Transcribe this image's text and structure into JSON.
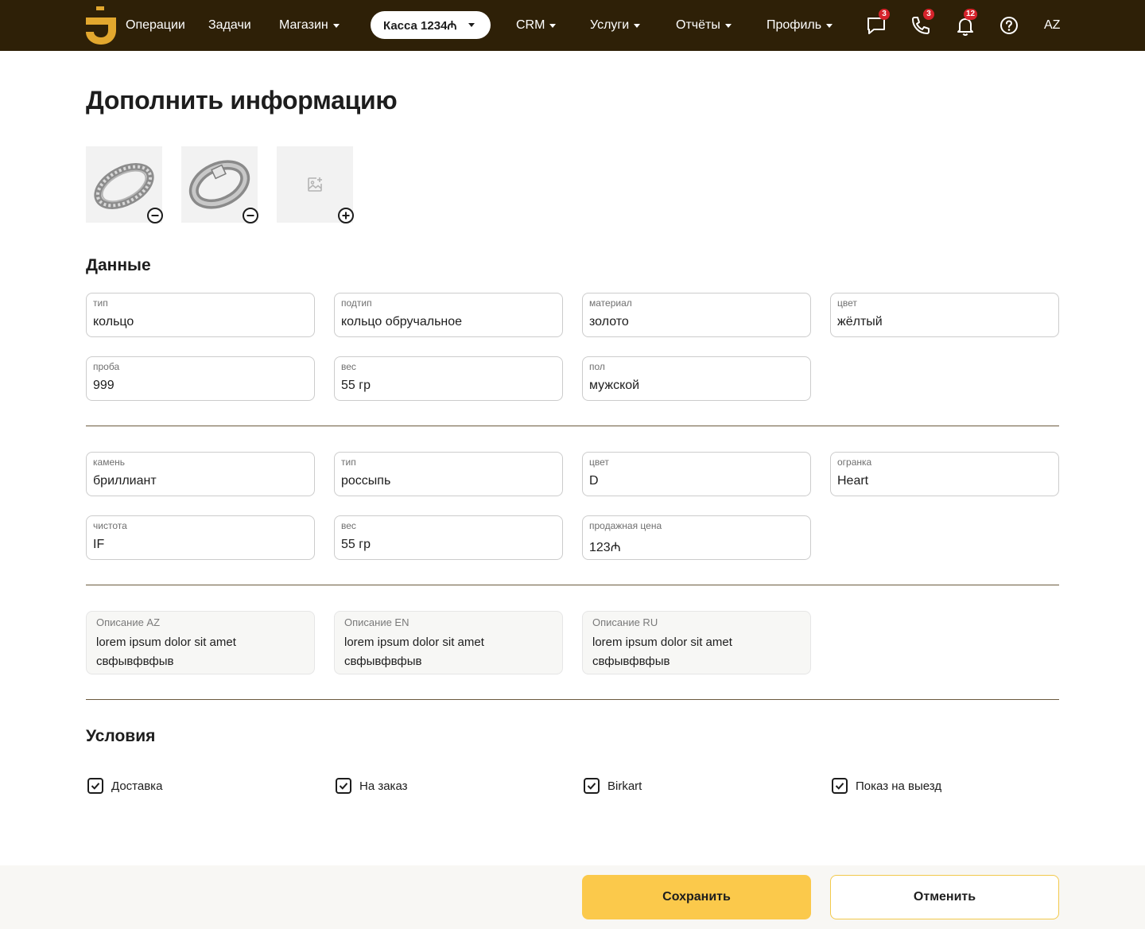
{
  "nav": {
    "logo_icon": "brand-logo-j",
    "items": [
      {
        "label": "Операции",
        "has_caret": false
      },
      {
        "label": "Задачи",
        "has_caret": false
      },
      {
        "label": "Магазин",
        "has_caret": true
      },
      {
        "label": "CRM",
        "has_caret": true
      },
      {
        "label": "Услуги",
        "has_caret": true
      },
      {
        "label": "Отчёты",
        "has_caret": true
      },
      {
        "label": "Профиль",
        "has_caret": true
      }
    ],
    "kassa_label": "Касса 1234₼",
    "badges": {
      "messages": "3",
      "calls": "3",
      "notifications": "12"
    },
    "icons": [
      "chat-icon",
      "phone-icon",
      "bell-icon",
      "help-icon"
    ],
    "language": "AZ"
  },
  "page": {
    "title": "Дополнить информацию"
  },
  "photos": {
    "items": [
      "ring-photo-1",
      "ring-photo-2"
    ],
    "add_placeholder_icon": "add-image-icon"
  },
  "data_section": {
    "title": "Данные",
    "item_fields": [
      {
        "label": "тип",
        "value": "кольцо"
      },
      {
        "label": "подтип",
        "value": "кольцо обручальное"
      },
      {
        "label": "материал",
        "value": "золото"
      },
      {
        "label": "цвет",
        "value": "жёлтый"
      },
      {
        "label": "проба",
        "value": "999"
      },
      {
        "label": "вес",
        "value": "55 гр"
      },
      {
        "label": "пол",
        "value": "мужской"
      }
    ],
    "stone_fields": [
      {
        "label": "камень",
        "value": "бриллиант"
      },
      {
        "label": "тип",
        "value": "россыпь"
      },
      {
        "label": "цвет",
        "value": "D"
      },
      {
        "label": "огранка",
        "value": "Heart"
      },
      {
        "label": "чистота",
        "value": "IF"
      },
      {
        "label": "вес",
        "value": "55 гр"
      },
      {
        "label": "продажная цена",
        "value": "123₼"
      }
    ],
    "descriptions": [
      {
        "label": "Описание AZ",
        "value": "lorem ipsum dolor sit amet свфывфвфыв"
      },
      {
        "label": "Описание EN",
        "value": "lorem ipsum dolor sit amet свфывфвфыв"
      },
      {
        "label": "Описание RU",
        "value": "lorem ipsum dolor sit amet свфывфвфыв"
      }
    ]
  },
  "conditions": {
    "title": "Условия",
    "options": [
      {
        "label": "Доставка",
        "checked": true
      },
      {
        "label": "На заказ",
        "checked": true
      },
      {
        "label": "Birkart",
        "checked": true
      },
      {
        "label": "Показ на выезд",
        "checked": true
      }
    ]
  },
  "footer": {
    "save_label": "Сохранить",
    "cancel_label": "Отменить"
  },
  "colors": {
    "topbar": "#2e2007",
    "brand_gold": "#e2a72e",
    "save_button": "#fbc94b",
    "badge": "#d5232b"
  }
}
